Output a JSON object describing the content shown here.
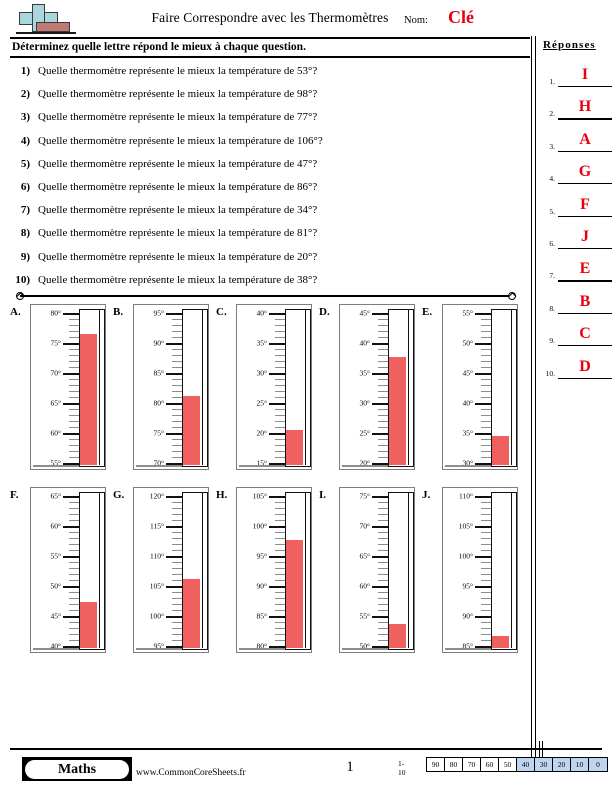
{
  "header": {
    "title": "Faire Correspondre avec les Thermomètres",
    "name_label": "Nom:",
    "name_value": "Clé",
    "logo_name": "commoncoresheets-logo"
  },
  "instructions": "Déterminez quelle lettre répond le mieux à chaque question.",
  "questions": [
    {
      "num": "1)",
      "text": "Quelle thermomètre représente le mieux la température de 53°?"
    },
    {
      "num": "2)",
      "text": "Quelle thermomètre représente le mieux la température de 98°?"
    },
    {
      "num": "3)",
      "text": "Quelle thermomètre représente le mieux la température de 77°?"
    },
    {
      "num": "4)",
      "text": "Quelle thermomètre représente le mieux la température de  106°?"
    },
    {
      "num": "5)",
      "text": "Quelle thermomètre représente le mieux la température de 47°?"
    },
    {
      "num": "6)",
      "text": "Quelle thermomètre représente le mieux la température de 86°?"
    },
    {
      "num": "7)",
      "text": "Quelle thermomètre représente le mieux la température de 34°?"
    },
    {
      "num": "8)",
      "text": "Quelle thermomètre représente le mieux la température de 81°?"
    },
    {
      "num": "9)",
      "text": "Quelle thermomètre représente le mieux la température de 20°?"
    },
    {
      "num": "10)",
      "text": "Quelle thermomètre représente le mieux la température de 38°?"
    }
  ],
  "answers": {
    "title": "Réponses",
    "accent_color": "#e8000b",
    "items": [
      {
        "num": "1.",
        "value": "I"
      },
      {
        "num": "2.",
        "value": "H"
      },
      {
        "num": "3.",
        "value": "A"
      },
      {
        "num": "4.",
        "value": "G"
      },
      {
        "num": "5.",
        "value": "F"
      },
      {
        "num": "6.",
        "value": "J"
      },
      {
        "num": "7.",
        "value": "E"
      },
      {
        "num": "8.",
        "value": "B"
      },
      {
        "num": "9.",
        "value": "C"
      },
      {
        "num": "10.",
        "value": "D"
      }
    ]
  },
  "thermometers": [
    {
      "label": "A.",
      "min": 55,
      "max": 80,
      "value": 77,
      "tick_labels": [
        "80°",
        "75°",
        "70°",
        "65°",
        "60°",
        "55°"
      ]
    },
    {
      "label": "B.",
      "min": 70,
      "max": 95,
      "value": 81,
      "tick_labels": [
        "95°",
        "90°",
        "85°",
        "80°",
        "75°",
        "70°"
      ]
    },
    {
      "label": "C.",
      "min": 15,
      "max": 40,
      "value": 20,
      "tick_labels": [
        "40°",
        "35°",
        "30°",
        "25°",
        "20°",
        "15°"
      ]
    },
    {
      "label": "D.",
      "min": 20,
      "max": 45,
      "value": 38,
      "tick_labels": [
        "45°",
        "40°",
        "35°",
        "30°",
        "25°",
        "20°"
      ]
    },
    {
      "label": "E.",
      "min": 30,
      "max": 55,
      "value": 34,
      "tick_labels": [
        "55°",
        "50°",
        "45°",
        "40°",
        "35°",
        "30°"
      ]
    },
    {
      "label": "F.",
      "min": 40,
      "max": 65,
      "value": 47,
      "tick_labels": [
        "65°",
        "60°",
        "55°",
        "50°",
        "45°",
        "40°"
      ]
    },
    {
      "label": "G.",
      "min": 95,
      "max": 120,
      "value": 106,
      "tick_labels": [
        "120°",
        "115°",
        "110°",
        "105°",
        "100°",
        "95°"
      ]
    },
    {
      "label": "H.",
      "min": 80,
      "max": 105,
      "value": 98,
      "tick_labels": [
        "105°",
        "100°",
        "95°",
        "90°",
        "85°",
        "80°"
      ]
    },
    {
      "label": "I.",
      "min": 50,
      "max": 75,
      "value": 53,
      "tick_labels": [
        "75°",
        "70°",
        "65°",
        "60°",
        "55°",
        "50°"
      ]
    },
    {
      "label": "J.",
      "min": 85,
      "max": 110,
      "value": 86,
      "tick_labels": [
        "110°",
        "105°",
        "100°",
        "95°",
        "90°",
        "85°"
      ]
    }
  ],
  "mercury_color": "#f0605f",
  "footer": {
    "brand": "Maths",
    "site": "www.CommonCoreSheets.fr",
    "page_number": "1",
    "score_range": "1-10",
    "score_cells": [
      {
        "value": "90",
        "highlighted": false
      },
      {
        "value": "80",
        "highlighted": false
      },
      {
        "value": "70",
        "highlighted": false
      },
      {
        "value": "60",
        "highlighted": false
      },
      {
        "value": "50",
        "highlighted": false
      },
      {
        "value": "40",
        "highlighted": true
      },
      {
        "value": "30",
        "highlighted": true
      },
      {
        "value": "20",
        "highlighted": true
      },
      {
        "value": "10",
        "highlighted": true
      },
      {
        "value": "0",
        "highlighted": true
      }
    ]
  }
}
